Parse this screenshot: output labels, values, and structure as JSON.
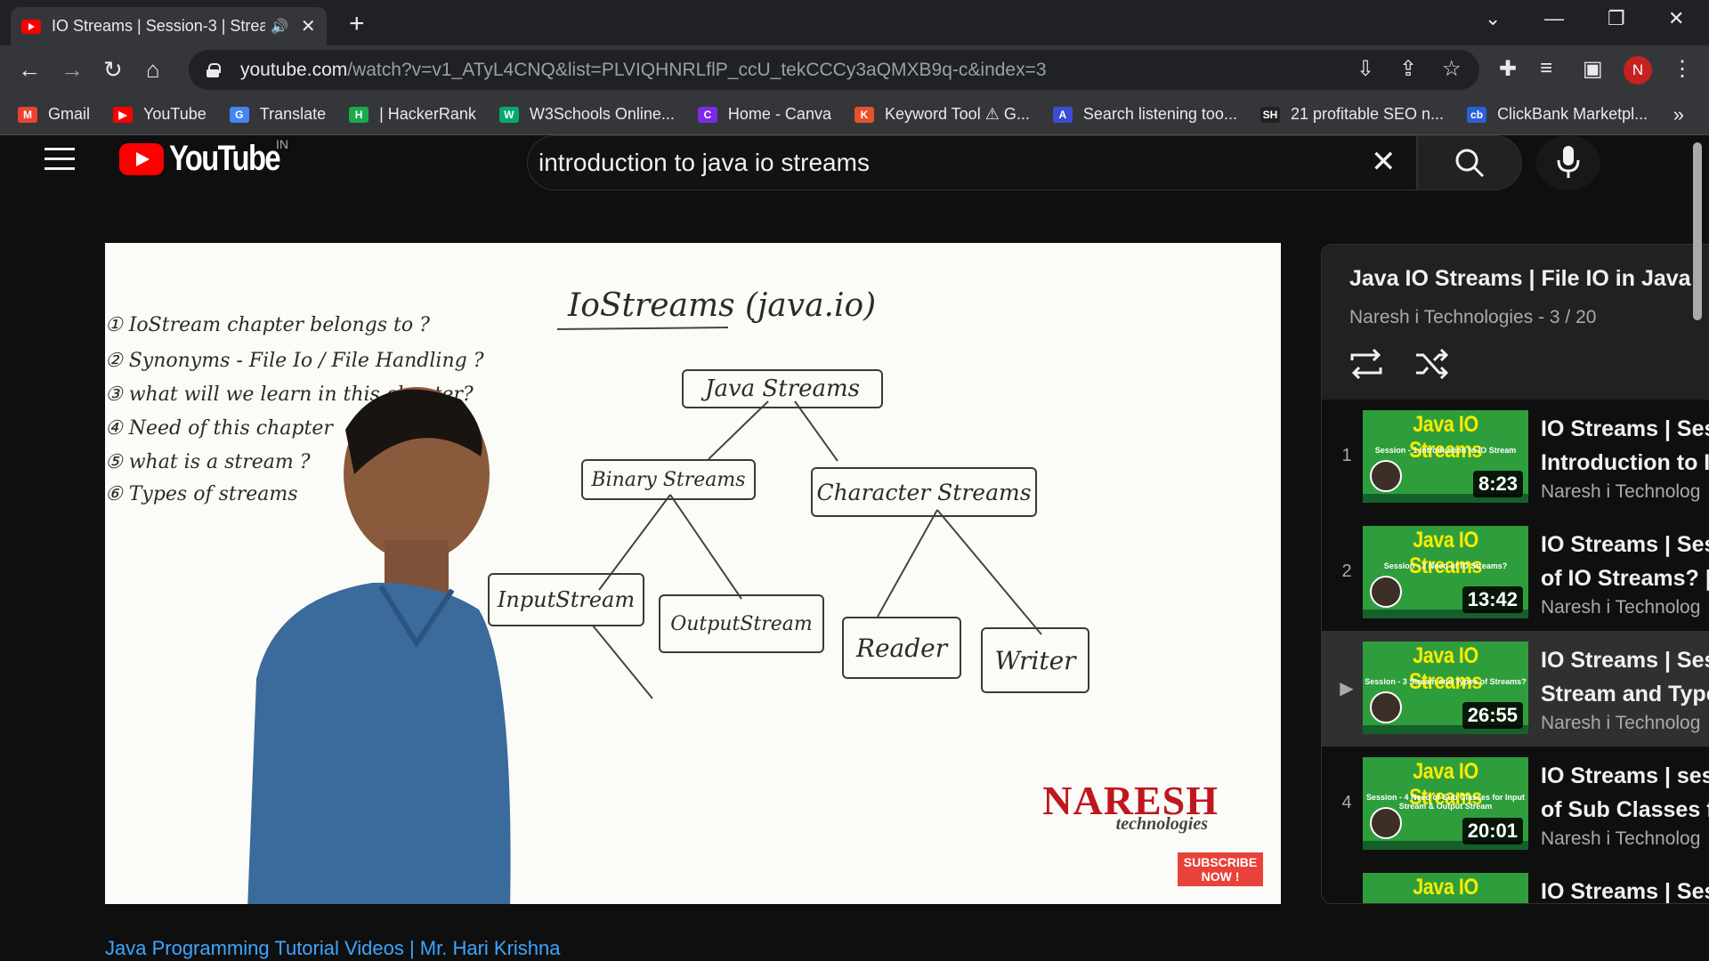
{
  "browser": {
    "tab_title": "IO Streams | Session-3 | Strea",
    "tab_audio_icon": "speaker-icon",
    "url_host": "youtube.com",
    "url_rest": "/watch?v=v1_ATyL4CNQ&list=PLVIQHNRLflP_ccU_tekCCCy3aQMXB9q-c&index=3",
    "profile_initial": "N",
    "bookmarks": [
      {
        "label": "Gmail",
        "color": "#ea4335",
        "glyph": "M"
      },
      {
        "label": "YouTube",
        "color": "#ff0000",
        "glyph": "▶"
      },
      {
        "label": "Translate",
        "color": "#4285f4",
        "glyph": "G"
      },
      {
        "label": "| HackerRank",
        "color": "#1ba94c",
        "glyph": "H"
      },
      {
        "label": "W3Schools Online...",
        "color": "#04aa6d",
        "glyph": "W"
      },
      {
        "label": "Home - Canva",
        "color": "#7d2ae8",
        "glyph": "C"
      },
      {
        "label": "Keyword Tool ⚠ G...",
        "color": "#e8512a",
        "glyph": "K"
      },
      {
        "label": "Search listening too...",
        "color": "#3d4cd6",
        "glyph": "A"
      },
      {
        "label": "21 profitable SEO n...",
        "color": "#222222",
        "glyph": "SH"
      },
      {
        "label": "ClickBank Marketpl...",
        "color": "#2b5fd9",
        "glyph": "cb"
      }
    ]
  },
  "youtube": {
    "logo_text": "YouTube",
    "country_code": "IN",
    "search_query": "introduction to java io streams",
    "video_below_link": "Java Programming Tutorial Videos | Mr. Hari Krishna",
    "whiteboard": {
      "title": "IoStreams (java.io)",
      "notes": [
        "① IoStream chapter belongs to ?",
        "② Synonyms - File Io / File Handling ?",
        "③ what will we learn in this chapter?",
        "④ Need of this chapter",
        "⑤ what is a stream ?",
        "⑥ Types of streams"
      ],
      "nodes": [
        "Java Streams",
        "Binary Streams",
        "Character Streams",
        "InputStream",
        "OutputStream",
        "Reader",
        "Writer"
      ],
      "brand": "NARESH",
      "brand_sub": "technologies",
      "subscribe": "SUBSCRIBE NOW !"
    },
    "playlist": {
      "title": "Java IO Streams | File IO in Java | C",
      "channel": "Naresh i Technologies",
      "position": "3 / 20",
      "meta": "Naresh i Technologies - 3 / 20",
      "items": [
        {
          "index": "1",
          "thumb_head": "Java IO Streams",
          "thumb_sub": "Session - 1  Introduction to IO Stream",
          "duration": "8:23",
          "line1": "IO Streams | Ses",
          "line2": "Introduction to I",
          "channel": "Naresh i Technolog"
        },
        {
          "index": "2",
          "thumb_head": "Java IO Streams",
          "thumb_sub": "Session - 2  Need of IO Streams?",
          "duration": "13:42",
          "line1": "IO Streams | Ses",
          "line2": "of IO Streams? |",
          "channel": "Naresh i Technolog"
        },
        {
          "index": "▶",
          "thumb_head": "Java IO Streams",
          "thumb_sub": "Session - 3  Stream and Types of Streams?",
          "duration": "26:55",
          "line1": "IO Streams | Ses",
          "line2": "Stream and Type",
          "channel": "Naresh i Technolog"
        },
        {
          "index": "4",
          "thumb_head": "Java IO Streams",
          "thumb_sub": "Session - 4  Need of Sub Classes for Input Stream & Output Stream",
          "duration": "20:01",
          "line1": "IO Streams | ses",
          "line2": "of Sub Classes f",
          "channel": "Naresh i Technolog"
        },
        {
          "index": "",
          "thumb_head": "Java IO Streams",
          "thumb_sub": "",
          "duration": "",
          "line1": "IO Streams | Ses",
          "line2": "",
          "channel": ""
        }
      ]
    }
  }
}
